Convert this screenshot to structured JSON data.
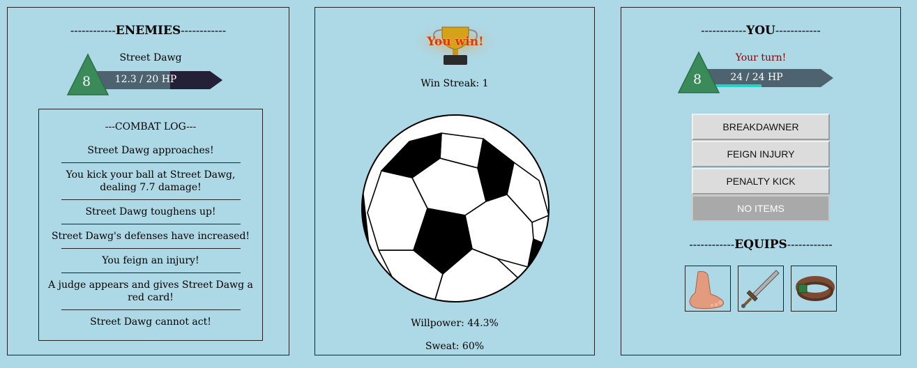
{
  "enemies": {
    "heading_prefix": "------------",
    "heading": "ENEMIES",
    "heading_suffix": "------------",
    "enemy_name": "Street Dawg",
    "level": "8",
    "hp_text": "12.3 / 20 HP",
    "hp_fraction": 0.615
  },
  "combat_log": {
    "title": "---COMBAT LOG---",
    "entries": [
      "Street Dawg approaches!",
      "You kick your ball at Street Dawg, dealing 7.7 damage!",
      "Street Dawg toughens up!",
      "Street Dawg's defenses have increased!",
      "You feign an injury!",
      "A judge appears and gives Street Dawg a red card!",
      "Street Dawg cannot act!"
    ]
  },
  "center": {
    "trophy_text": "You win!",
    "win_streak": "Win Streak: 1",
    "willpower": "Willpower: 44.3%",
    "sweat": "Sweat: 60%"
  },
  "player": {
    "heading_prefix": "------------",
    "heading": "YOU",
    "heading_suffix": "------------",
    "turn_text": "Your turn!",
    "level": "8",
    "hp_text": "24 / 24 HP",
    "hp_fraction": 1.0
  },
  "actions": {
    "breakdawner": "BREAKDAWNER",
    "feign_injury": "FEIGN INJURY",
    "penalty_kick": "PENALTY KICK",
    "no_items": "NO ITEMS"
  },
  "equips": {
    "heading_prefix": "------------",
    "heading": "EQUIPS",
    "heading_suffix": "------------",
    "items": [
      "foot-icon",
      "sword-icon",
      "ring-icon"
    ]
  },
  "colors": {
    "background": "#add8e6",
    "hp_bar": "#4d6470",
    "hp_missing": "#232038",
    "hp_accent": "#22d3c8",
    "level_triangle": "#3a8a5a",
    "turn_text": "#8b0000"
  }
}
